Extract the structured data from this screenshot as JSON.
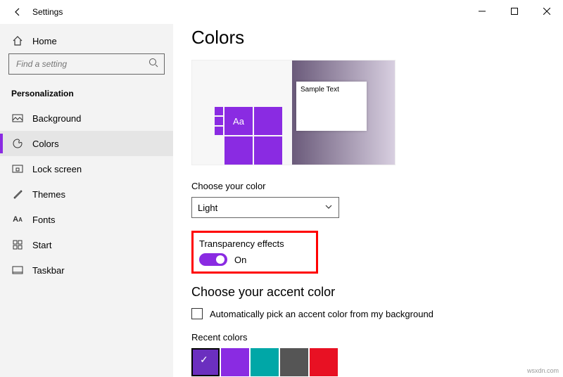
{
  "window": {
    "title": "Settings"
  },
  "sidebar": {
    "home_label": "Home",
    "search_placeholder": "Find a setting",
    "category_label": "Personalization",
    "items": [
      {
        "label": "Background"
      },
      {
        "label": "Colors"
      },
      {
        "label": "Lock screen"
      },
      {
        "label": "Themes"
      },
      {
        "label": "Fonts"
      },
      {
        "label": "Start"
      },
      {
        "label": "Taskbar"
      }
    ]
  },
  "main": {
    "heading": "Colors",
    "preview_sample_text": "Sample Text",
    "preview_tile_text": "Aa",
    "choose_color_label": "Choose your color",
    "choose_color_value": "Light",
    "transparency_label": "Transparency effects",
    "transparency_state": "On",
    "accent_heading": "Choose your accent color",
    "auto_accent_label": "Automatically pick an accent color from my background",
    "recent_label": "Recent colors",
    "recent_colors": [
      "#6b2fbf",
      "#8a2be2",
      "#00a7a7",
      "#555555",
      "#e81123"
    ]
  },
  "watermark": "wsxdn.com"
}
